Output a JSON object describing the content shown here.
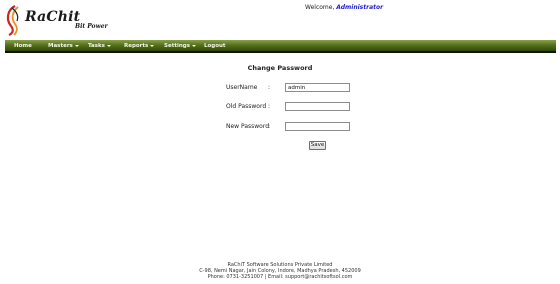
{
  "header": {
    "logo_name": "RaChit",
    "logo_tagline": "Bit Power",
    "welcome_prefix": "Welcome,",
    "welcome_user": "Administrator"
  },
  "nav": {
    "items": [
      {
        "label": "Home",
        "has_menu": false
      },
      {
        "label": "Masters",
        "has_menu": true
      },
      {
        "label": "Tasks",
        "has_menu": true
      },
      {
        "label": "Reports",
        "has_menu": true
      },
      {
        "label": "Settings",
        "has_menu": true
      },
      {
        "label": "Logout",
        "has_menu": false
      }
    ]
  },
  "form": {
    "title": "Change Password",
    "username_label": "UserName",
    "username_value": "admin",
    "old_password_label": "Old Password",
    "new_password_label": "New Password",
    "colon": ":",
    "save_label": "Save"
  },
  "footer": {
    "line1": "RaChiT Software Solutions Private Limited",
    "line2": "C-98, Nemi Nagar, Jain Colony, Indore, Madhya Pradesh, 452009",
    "line3": "Phone: 0731-3251007 | Email: support@rachitsoftsol.com"
  },
  "colors": {
    "nav_top": "#8aa14a",
    "nav_bottom": "#2f4708",
    "welcome_user": "#2222cc",
    "logo_swoosh_red": "#c8281e",
    "logo_swoosh_orange": "#f08c1e"
  }
}
